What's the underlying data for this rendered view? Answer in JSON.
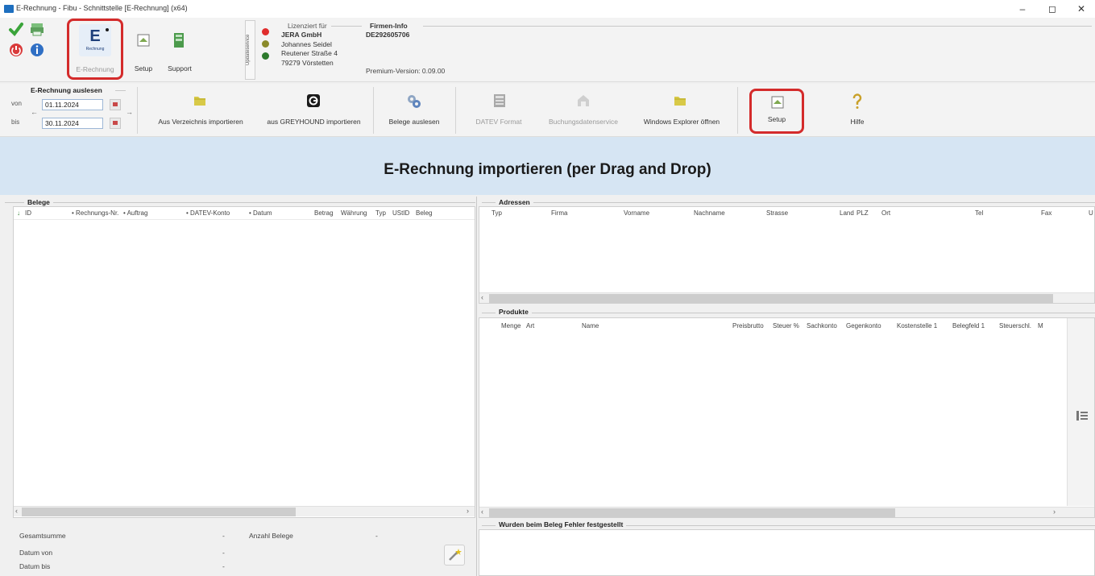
{
  "window": {
    "title": "E-Rechnung - Fibu - Schnittstelle [E-Rechnung] (x64)",
    "minimize": "–",
    "maximize": "◻",
    "close": "✕"
  },
  "ribbon1": {
    "erechnung_icon_letter": "E",
    "erechnung_icon_sub": "Rechnung",
    "erechnung_label": "E-Rechnung",
    "setup_label": "Setup",
    "support_label": "Support",
    "updateservice_label": "Updateservice",
    "licensed_for_label": "Lizenziert für",
    "license_company": "JERA GmbH",
    "license_name": "Johannes Seidel",
    "license_street": "Reutener Straße 4",
    "license_city": "79279 Vörstetten",
    "firmeninfo_label": "Firmen-Info",
    "firmeninfo_id": "DE292605706",
    "premium_version": "Premium-Version: 0.09.00"
  },
  "ribbon2": {
    "group_title": "E-Rechnung auslesen",
    "von_label": "von",
    "bis_label": "bis",
    "date_from": "01.11.2024",
    "date_to": "30.11.2024",
    "btn_import_dir": "Aus Verzeichnis importieren",
    "btn_import_greyhound": "aus GREYHOUND importieren",
    "btn_belege_auslesen": "Belege auslesen",
    "btn_datev_format": "DATEV Format",
    "btn_buchungsdatenservice": "Buchungsdatenservice",
    "btn_explorer": "Windows Explorer öffnen",
    "btn_setup": "Setup",
    "btn_hilfe": "Hilfe"
  },
  "banner": {
    "text": "E-Rechnung importieren (per Drag and Drop)"
  },
  "belege": {
    "title": "Belege",
    "columns": [
      "ID",
      "Rechnungs-Nr.",
      "Auftrag",
      "DATEV-Konto",
      "Datum",
      "Betrag",
      "Währung",
      "Typ",
      "UStID",
      "Beleg"
    ]
  },
  "adressen": {
    "title": "Adressen",
    "columns": [
      "Typ",
      "Firma",
      "Vorname",
      "Nachname",
      "Strasse",
      "Land",
      "PLZ",
      "Ort",
      "Tel",
      "Fax",
      "U"
    ]
  },
  "produkte": {
    "title": "Produkte",
    "columns": [
      "Menge",
      "Art",
      "Name",
      "Preisbrutto",
      "Steuer %",
      "Sachkonto",
      "Gegenkonto",
      "Kostenstelle 1",
      "Belegfeld 1",
      "Steuerschl.",
      "M"
    ]
  },
  "summary": {
    "gesamtsumme_label": "Gesamtsumme",
    "gesamtsumme_value": "-",
    "anzahl_label": "Anzahl Belege",
    "anzahl_value": "-",
    "datum_von_label": "Datum von",
    "datum_von_value": "-",
    "datum_bis_label": "Datum bis",
    "datum_bis_value": "-"
  },
  "fehler": {
    "title": "Wurden beim Beleg Fehler festgestellt"
  },
  "colors": {
    "banner_bg": "#d6e5f3",
    "highlight": "#d42b2b",
    "accent": "#1e6fbf"
  }
}
